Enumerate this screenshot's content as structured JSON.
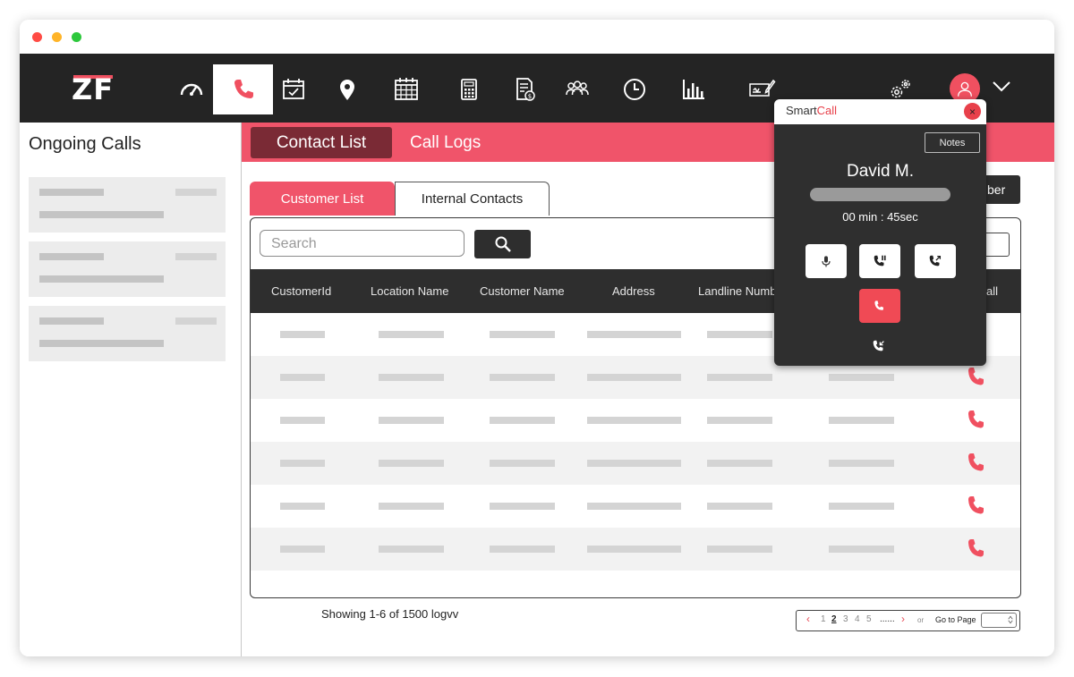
{
  "app": {
    "logo_text": "ZF",
    "accent_color": "#f05060",
    "traffic_lights": [
      "#ff4b44",
      "#ffb428",
      "#2dc83c"
    ]
  },
  "topnav": {
    "icons": [
      "speedometer-icon",
      "phone-icon",
      "calendar-check-icon",
      "location-pin-icon",
      "calendar-grid-icon",
      "calculator-icon",
      "document-money-icon",
      "group-icon",
      "clock-icon",
      "bar-chart-icon",
      "signature-icon",
      "settings-gears-icon",
      "user-icon",
      "chevron-down-icon"
    ],
    "active": "phone-icon"
  },
  "sidebar": {
    "title": "Ongoing Calls",
    "cards": [
      1,
      2,
      3
    ]
  },
  "header_tabs": {
    "contact_list": "Contact List",
    "call_logs": "Call Logs"
  },
  "sub_tabs": {
    "customer_list": "Customer List",
    "internal_contacts": "Internal Contacts"
  },
  "right_button_partial": "ber",
  "search": {
    "placeholder": "Search"
  },
  "table": {
    "columns": [
      "CustomerId",
      "Location Name",
      "Customer Name",
      "Address",
      "Landline Numb",
      "all"
    ],
    "rows_count": 6
  },
  "footer": {
    "showing": "Showing 1-6 of 1500 logvv"
  },
  "pagination": {
    "prev": "‹",
    "pages": [
      "1",
      "2",
      "3",
      "4",
      "5"
    ],
    "current": "2",
    "ellipsis": "......",
    "next": "›",
    "or": "or",
    "go_to_page": "Go to Page"
  },
  "smartcall": {
    "title_prefix": "Smart",
    "title_suffix": "Call",
    "close": "×",
    "notes": "Notes",
    "caller": "David M.",
    "timer": "00 min : 45sec"
  }
}
